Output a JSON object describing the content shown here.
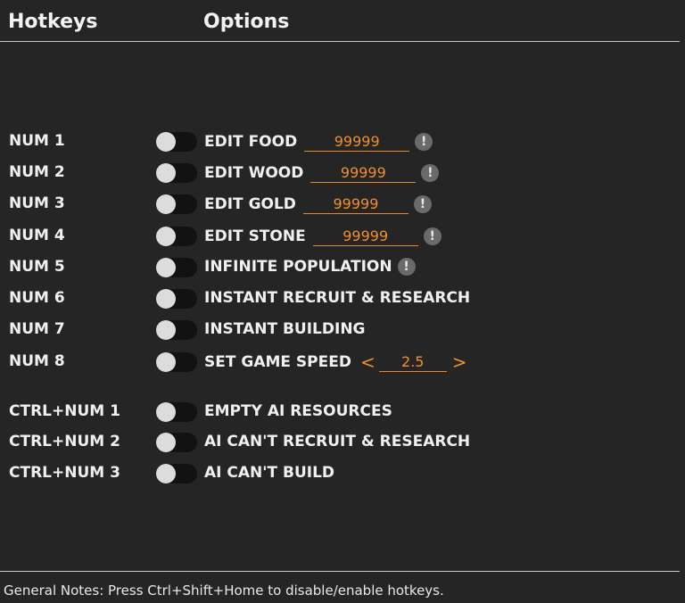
{
  "header": {
    "hotkeys_title": "Hotkeys",
    "options_title": "Options"
  },
  "rows": [
    {
      "key": "NUM 1",
      "label": "EDIT FOOD",
      "value": "99999",
      "info": "!",
      "toggle_on": false
    },
    {
      "key": "NUM 2",
      "label": "EDIT WOOD",
      "value": "99999",
      "info": "!",
      "toggle_on": false
    },
    {
      "key": "NUM 3",
      "label": "EDIT GOLD",
      "value": "99999",
      "info": "!",
      "toggle_on": false
    },
    {
      "key": "NUM 4",
      "label": "EDIT STONE",
      "value": "99999",
      "info": "!",
      "toggle_on": false
    },
    {
      "key": "NUM 5",
      "label": "INFINITE POPULATION",
      "info": "!",
      "toggle_on": false
    },
    {
      "key": "NUM 6",
      "label": "INSTANT RECRUIT & RESEARCH",
      "toggle_on": false
    },
    {
      "key": "NUM 7",
      "label": "INSTANT BUILDING",
      "toggle_on": false
    },
    {
      "key": "NUM 8",
      "label": "SET GAME SPEED",
      "value": "2.5",
      "decrease": "<",
      "increase": ">",
      "toggle_on": false
    },
    {
      "key": "CTRL+NUM 1",
      "label": "EMPTY AI RESOURCES",
      "toggle_on": false
    },
    {
      "key": "CTRL+NUM 2",
      "label": "AI CAN'T RECRUIT & RESEARCH",
      "toggle_on": false
    },
    {
      "key": "CTRL+NUM 3",
      "label": "AI CAN'T BUILD",
      "toggle_on": false
    }
  ],
  "footer": {
    "notes": "General Notes: Press Ctrl+Shift+Home to disable/enable hotkeys."
  },
  "colors": {
    "background": "#252526",
    "accent": "#f0902a",
    "text": "#f0f0f0",
    "toggle_track": "#121212",
    "toggle_knob": "#dcdcdc",
    "info_badge": "#6a6a6a"
  }
}
